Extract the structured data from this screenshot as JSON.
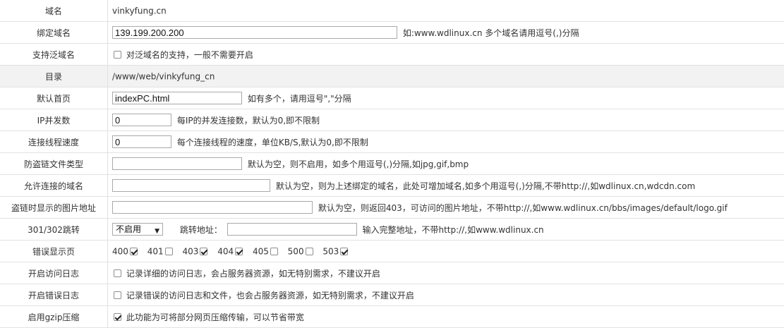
{
  "rows": {
    "domain": {
      "label": "域名",
      "value": "vinkyfung.cn"
    },
    "bind": {
      "label": "绑定域名",
      "value": "139.199.200.200",
      "hint": "如:www.wdlinux.cn 多个域名请用逗号(,)分隔"
    },
    "wildcard": {
      "label": "支持泛域名",
      "checked": false,
      "text": "对泛域名的支持，一般不需要开启"
    },
    "dir": {
      "label": "目录",
      "value": "/www/web/vinkyfung_cn"
    },
    "index": {
      "label": "默认首页",
      "value": "indexPC.html",
      "hint": "如有多个，请用逗号\",\"分隔"
    },
    "ipconn": {
      "label": "IP并发数",
      "value": "0",
      "hint": "每IP的并发连接数，默认为0,即不限制"
    },
    "speed": {
      "label": "连接线程速度",
      "value": "0",
      "hint": "每个连接线程的速度，单位KB/S,默认为0,即不限制"
    },
    "hotlink_types": {
      "label": "防盗链文件类型",
      "value": "",
      "hint": "默认为空，则不启用，如多个用逗号(,)分隔,如jpg,gif,bmp"
    },
    "allowed_domains": {
      "label": "允许连接的域名",
      "value": "",
      "hint": "默认为空，则为上述绑定的域名，此处可增加域名,如多个用逗号(,)分隔,不带http://,如wdlinux.cn,wdcdn.com"
    },
    "hotlink_image": {
      "label": "盗链时显示的图片地址",
      "value": "",
      "hint": "默认为空，则返回403，可访问的图片地址，不带http://,如www.wdlinux.cn/bbs/images/default/logo.gif"
    },
    "redirect": {
      "label": "301/302跳转",
      "select_value": "不启用",
      "target_label": "跳转地址：",
      "value": "",
      "hint": "输入完整地址，不带http://,如www.wdlinux.cn"
    },
    "error_pages": {
      "label": "错误显示页",
      "codes": [
        {
          "code": "400",
          "checked": true
        },
        {
          "code": "401",
          "checked": false
        },
        {
          "code": "403",
          "checked": true
        },
        {
          "code": "404",
          "checked": true
        },
        {
          "code": "405",
          "checked": false
        },
        {
          "code": "500",
          "checked": false
        },
        {
          "code": "503",
          "checked": true
        }
      ]
    },
    "access_log": {
      "label": "开启访问日志",
      "checked": false,
      "text": "记录详细的访问日志，会占服务器资源，如无特别需求，不建议开启"
    },
    "error_log": {
      "label": "开启错误日志",
      "checked": false,
      "text": "记录错误的访问日志和文件，也会占服务器资源，如无特别需求，不建议开启"
    },
    "gzip": {
      "label": "启用gzip压缩",
      "checked": true,
      "text": "此功能为可将部分网页压缩传输，可以节省带宽"
    }
  }
}
